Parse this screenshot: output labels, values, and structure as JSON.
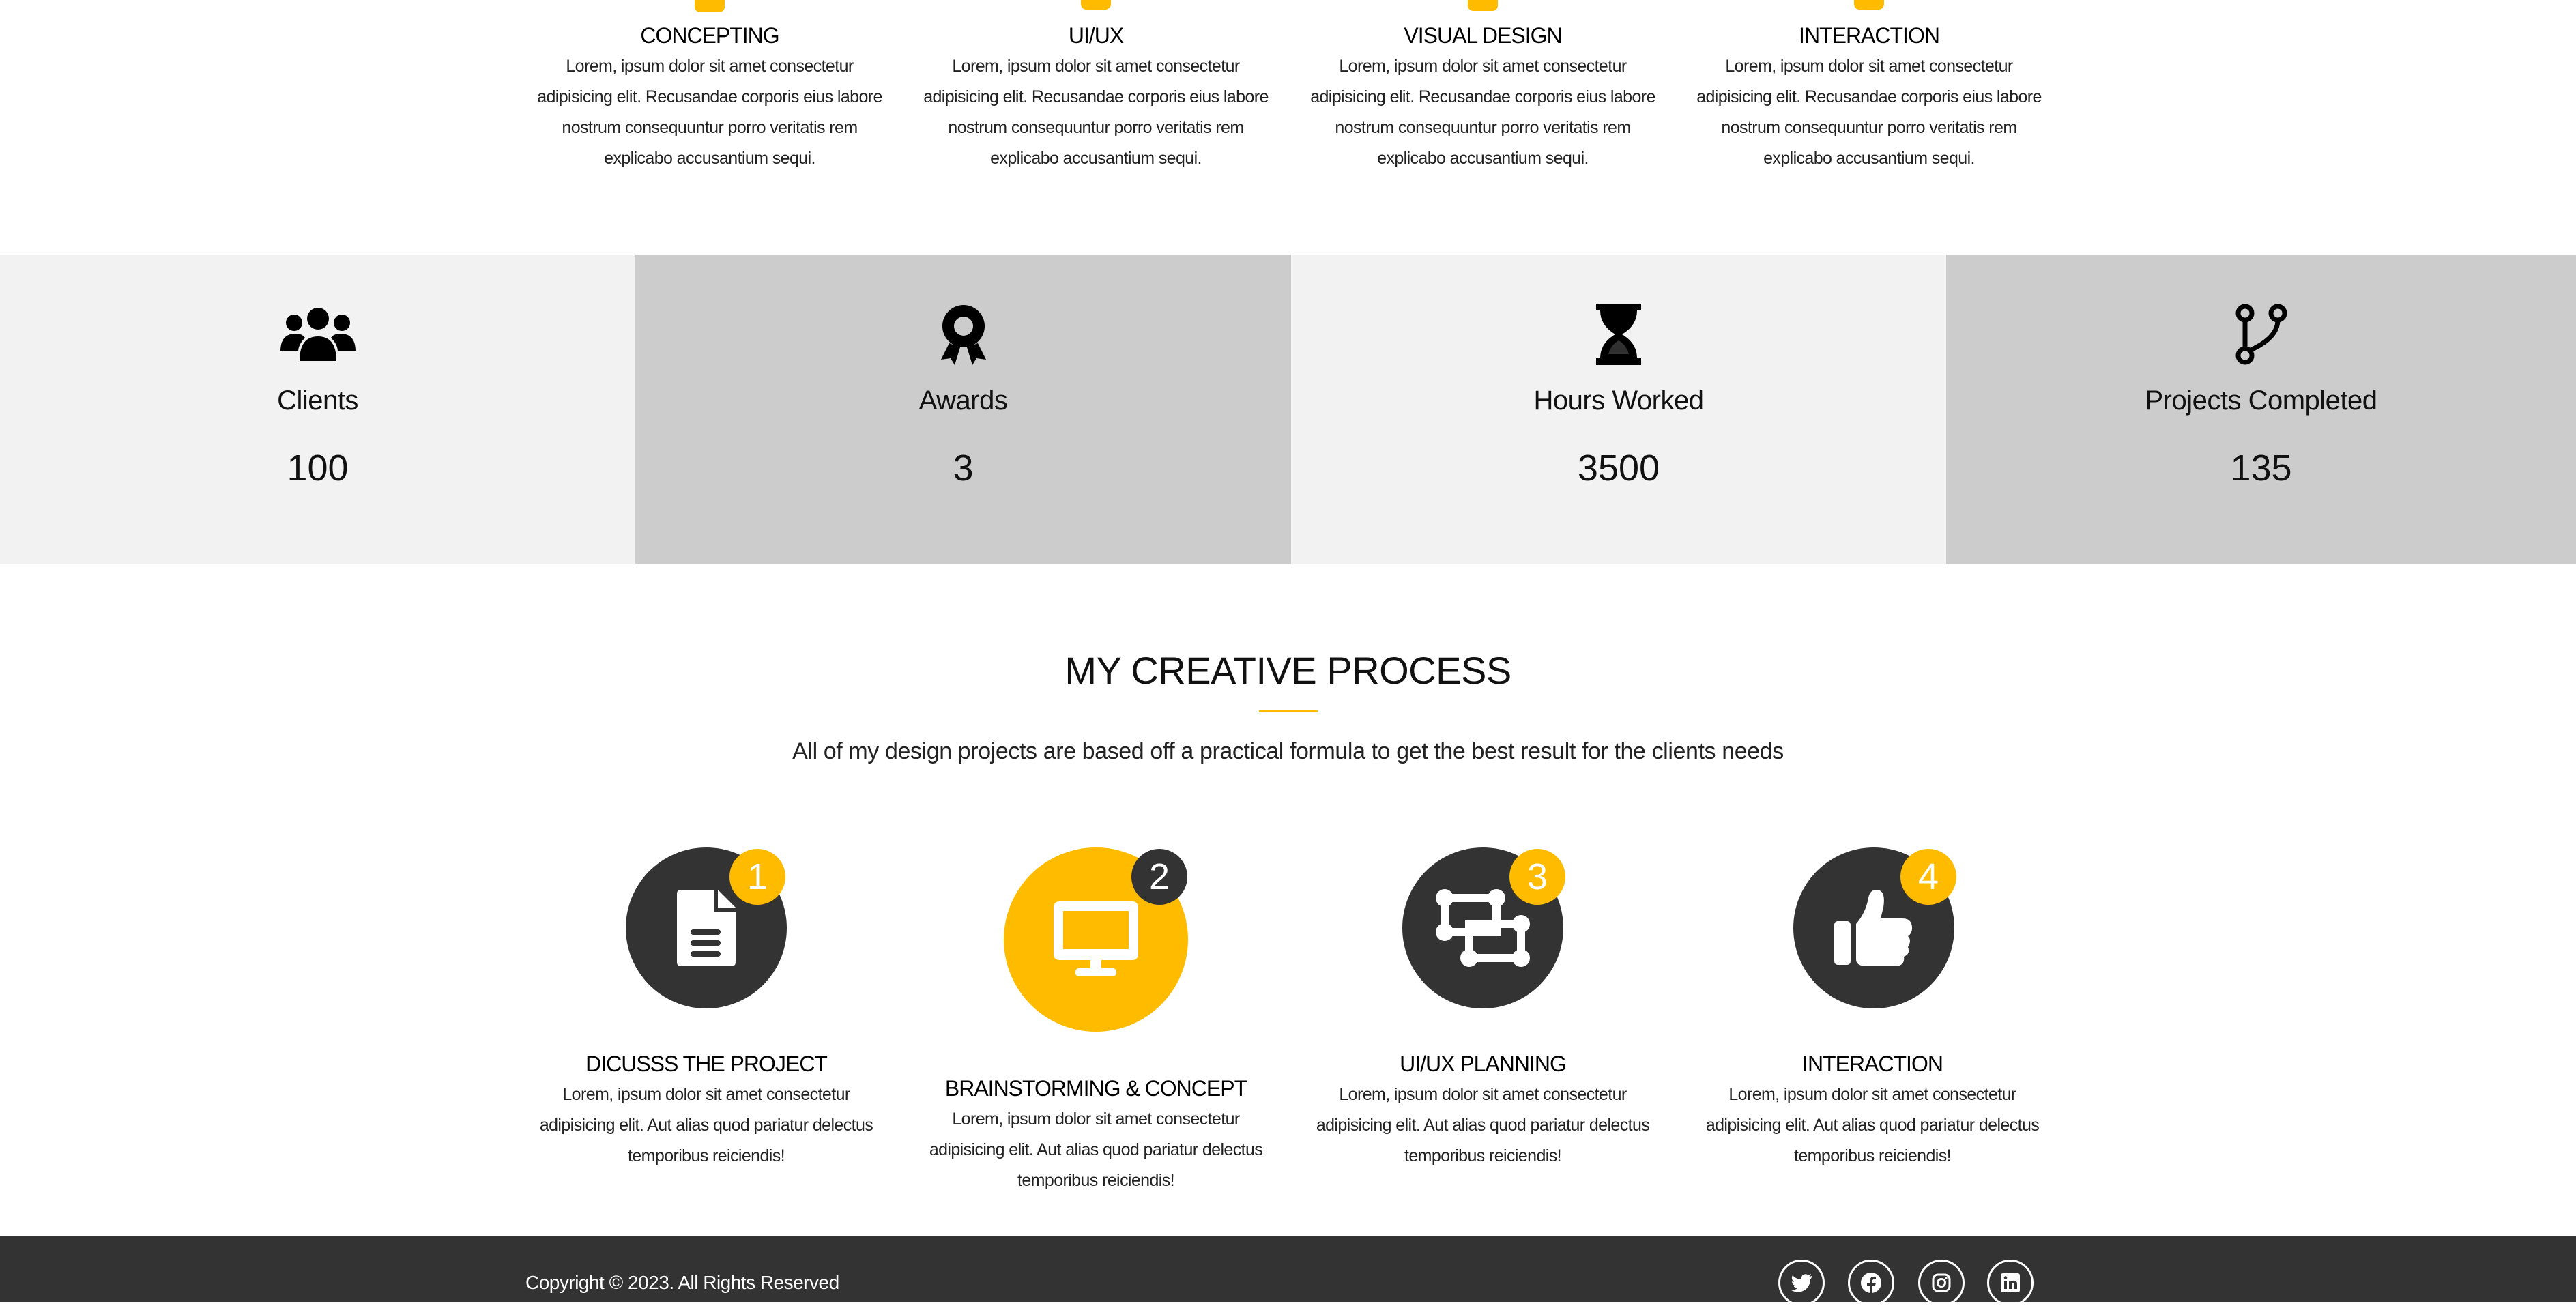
{
  "services": [
    {
      "title": "CONCEPTING",
      "lines": [
        "Lorem, ipsum dolor sit amet consectetur",
        "adipisicing elit. Recusandae corporis eius labore",
        "nostrum consequuntur porro veritatis rem",
        "explicabo accusantium sequi."
      ]
    },
    {
      "title": "UI/UX",
      "lines": [
        "Lorem, ipsum dolor sit amet consectetur",
        "adipisicing elit. Recusandae corporis eius labore",
        "nostrum consequuntur porro veritatis rem",
        "explicabo accusantium sequi."
      ]
    },
    {
      "title": "VISUAL DESIGN",
      "lines": [
        "Lorem, ipsum dolor sit amet consectetur",
        "adipisicing elit. Recusandae corporis eius labore",
        "nostrum consequuntur porro veritatis rem",
        "explicabo accusantium sequi."
      ]
    },
    {
      "title": "INTERACTION",
      "lines": [
        "Lorem, ipsum dolor sit amet consectetur",
        "adipisicing elit. Recusandae corporis eius labore",
        "nostrum consequuntur porro veritatis rem",
        "explicabo accusantium sequi."
      ]
    }
  ],
  "stats": [
    {
      "icon": "users-icon",
      "label": "Clients",
      "value": "100"
    },
    {
      "icon": "award-icon",
      "label": "Awards",
      "value": "3"
    },
    {
      "icon": "hourglass-icon",
      "label": "Hours Worked",
      "value": "3500"
    },
    {
      "icon": "code-branch-icon",
      "label": "Projects Completed",
      "value": "135"
    }
  ],
  "process": {
    "title": "MY CREATIVE PROCESS",
    "subtitle": "All of my design projects are based off a practical formula to get the best result for the clients needs",
    "steps": [
      {
        "num": "1",
        "icon": "file-icon",
        "title": "DICUSSS THE PROJECT",
        "lines": [
          "Lorem, ipsum dolor sit amet consectetur",
          "adipisicing elit. Aut alias quod pariatur delectus",
          "temporibus reiciendis!"
        ]
      },
      {
        "num": "2",
        "icon": "desktop-icon",
        "title": "BRAINSTORMING & CONCEPT",
        "lines": [
          "Lorem, ipsum dolor sit amet consectetur",
          "adipisicing elit. Aut alias quod pariatur delectus",
          "temporibus reiciendis!"
        ]
      },
      {
        "num": "3",
        "icon": "object-ungroup-icon",
        "title": "UI/UX PLANNING",
        "lines": [
          "Lorem, ipsum dolor sit amet consectetur",
          "adipisicing elit. Aut alias quod pariatur delectus",
          "temporibus reiciendis!"
        ]
      },
      {
        "num": "4",
        "icon": "thumbs-up-icon",
        "title": "INTERACTION",
        "lines": [
          "Lorem, ipsum dolor sit amet consectetur",
          "adipisicing elit. Aut alias quod pariatur delectus",
          "temporibus reiciendis!"
        ]
      }
    ]
  },
  "footer": {
    "copyright": "Copyright © 2023. All Rights Reserved",
    "social": [
      "twitter-icon",
      "facebook-icon",
      "instagram-icon",
      "linkedin-icon"
    ]
  },
  "colors": {
    "accent": "#ffbb00",
    "dark": "#333333",
    "stat_light": "#f2f2f2",
    "stat_dark": "#cccccc"
  }
}
